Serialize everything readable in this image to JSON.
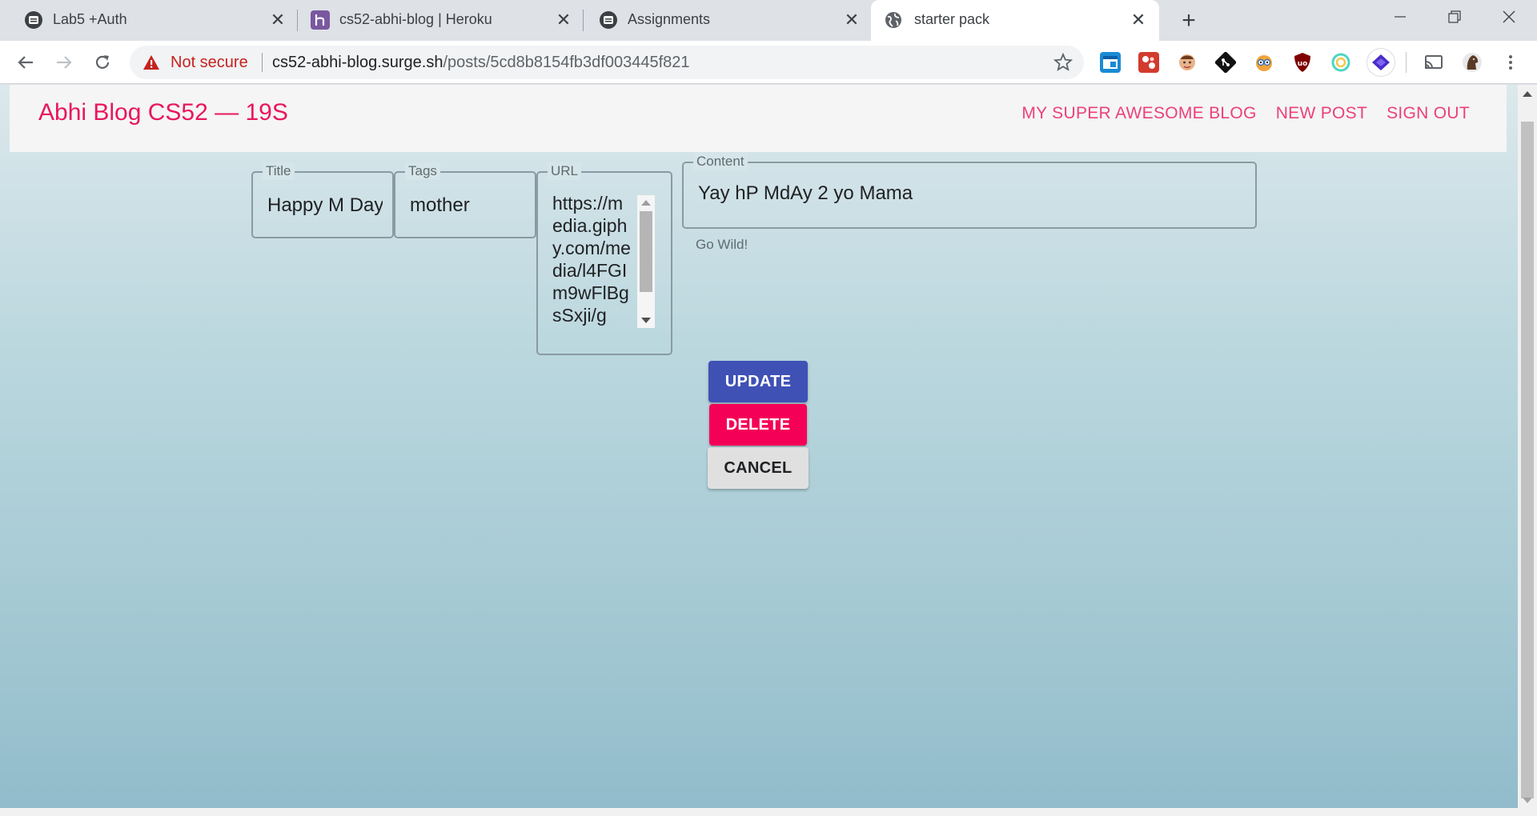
{
  "browser": {
    "tabs": [
      {
        "title": "Lab5 +Auth",
        "icon": "generic-page-icon",
        "active": false
      },
      {
        "title": "cs52-abhi-blog | Heroku",
        "icon": "heroku-icon",
        "active": false
      },
      {
        "title": "Assignments",
        "icon": "generic-page-icon",
        "active": false
      },
      {
        "title": "starter pack",
        "icon": "globe-icon",
        "active": true
      }
    ],
    "security_label": "Not secure",
    "url_host": "cs52-abhi-blog.surge.sh",
    "url_path": "/posts/5cd8b8154fb3df003445f821"
  },
  "app": {
    "brand": "Abhi Blog CS52 — 19S",
    "nav": [
      "MY SUPER AWESOME BLOG",
      "NEW POST",
      "SIGN OUT"
    ]
  },
  "form": {
    "title_label": "Title",
    "title_value": "Happy M Day",
    "tags_label": "Tags",
    "tags_value": "mother",
    "url_label": "URL",
    "url_value": "https://media.giphy.com/media/l4FGIm9wFlBgsSxji/g",
    "content_label": "Content",
    "content_value": "Yay hP MdAy 2 yo Mama",
    "content_helper": "Go Wild!"
  },
  "buttons": {
    "update": "UPDATE",
    "delete": "DELETE",
    "cancel": "CANCEL"
  }
}
